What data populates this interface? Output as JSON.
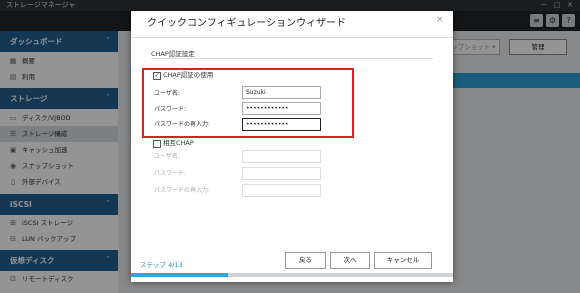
{
  "window": {
    "title": "ストレージマネージャ",
    "controls": [
      "－",
      "□",
      "✕"
    ]
  },
  "toolbar": {
    "icons": [
      "stack-icon",
      "gear-icon",
      "help-icon"
    ]
  },
  "sidebar": {
    "sections": [
      {
        "label": "ダッシュボード",
        "collapse": "ˇ",
        "items": [
          {
            "icon": "grid-icon",
            "label": "概要"
          },
          {
            "icon": "chart-icon",
            "label": "利用"
          }
        ]
      },
      {
        "label": "ストレージ",
        "collapse": "ˇ",
        "items": [
          {
            "icon": "disk-icon",
            "label": "ディスク/VJBOD"
          },
          {
            "icon": "list-icon",
            "label": "ストレージ構成",
            "active": true
          },
          {
            "icon": "cache-icon",
            "label": "キャッシュ加速"
          },
          {
            "icon": "camera-icon",
            "label": "スナップショット"
          },
          {
            "icon": "external-device-icon",
            "label": "外部デバイス"
          }
        ]
      },
      {
        "label": "iSCSI",
        "collapse": "ˇ",
        "items": [
          {
            "icon": "iscsi-icon",
            "label": "iSCSI ストレージ"
          },
          {
            "icon": "backup-icon",
            "label": "LUN バックアップ"
          }
        ]
      },
      {
        "label": "仮想ディスク",
        "collapse": "ˇ",
        "items": [
          {
            "icon": "remote-disk-icon",
            "label": "リモートディスク"
          }
        ]
      }
    ]
  },
  "background": {
    "snapshot_button": "ナップショット ▾",
    "manage_button": "管理"
  },
  "dialog": {
    "title": "クイックコンフィギュレーションウィザード",
    "close": "×",
    "section": "CHAP認証設定",
    "chap": {
      "checkbox_label": "CHAP認証の使用",
      "checked": true,
      "username_label": "ユーザ名:",
      "username_value": "Suzuki",
      "password_label": "パスワード:",
      "password_value": "••••••••••••",
      "confirm_label": "パスワードの再入力:",
      "confirm_value": "••••••••••••"
    },
    "mutual": {
      "checkbox_label": "相互CHAP",
      "checked": false,
      "username_label": "ユーザ名:",
      "password_label": "パスワード:",
      "confirm_label": "パスワードの再入力:"
    },
    "step": "ステップ 4/13",
    "progress": 0.3,
    "buttons": {
      "back": "戻る",
      "next": "次へ",
      "cancel": "キャンセル"
    }
  },
  "colors": {
    "accent": "#28a7e0",
    "sidebar_header": "#24608f",
    "highlight": "#e02020"
  }
}
